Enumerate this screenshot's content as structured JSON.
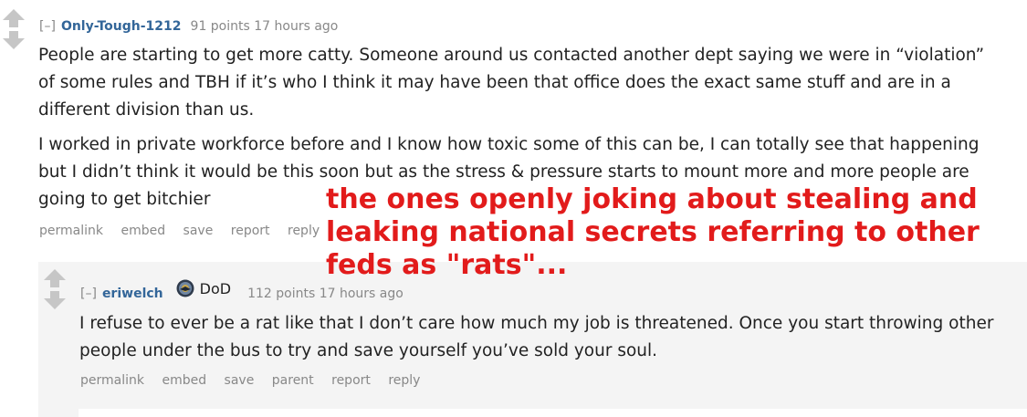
{
  "comment_1": {
    "collapse_label": "[–]",
    "author": "Only-Tough-1212",
    "points": "91 points",
    "time": "17 hours ago",
    "paragraphs": [
      "People are starting to get more catty. Someone around us contacted another dept saying we were in “violation” of some rules and TBH if it’s who I think it may have been that office does the exact same stuff and are in a different division than us.",
      "I worked in private workforce before and I know how toxic some of this can be, I can totally see that happening but I didn’t think it would be this soon but as the stress & pressure starts to mount more and more people are going to get bitchier"
    ],
    "buttons": [
      "permalink",
      "embed",
      "save",
      "report",
      "reply"
    ]
  },
  "comment_2": {
    "collapse_label": "[–]",
    "author": "eriwelch",
    "flair": "DoD",
    "points": "112 points",
    "time": "17 hours ago",
    "paragraphs": [
      "I refuse to ever be a rat like that I don’t care how much my job is threatened. Once you start throwing other people under the bus to try and save yourself you’ve sold your soul."
    ],
    "buttons": [
      "permalink",
      "embed",
      "save",
      "parent",
      "report",
      "reply"
    ]
  },
  "annotation": {
    "lines": [
      "the ones openly joking about stealing and",
      "leaking national secrets referring to other",
      "feds as \"rats\"..."
    ],
    "color": "#e21b1b"
  },
  "colors": {
    "author": "#336699",
    "meta": "#888888",
    "child_background": "#f4f4f4"
  },
  "icons": {
    "vote_arrows": "up-down-arrows",
    "flair": "dod-seal-icon"
  }
}
